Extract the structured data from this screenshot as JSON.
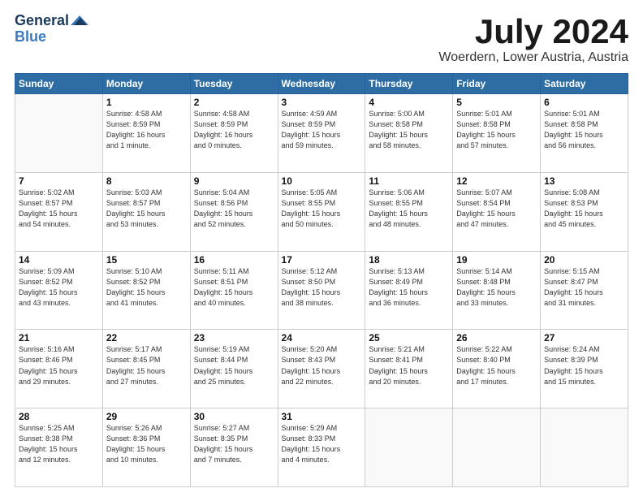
{
  "logo": {
    "line1": "General",
    "line2": "Blue"
  },
  "title": "July 2024",
  "location": "Woerdern, Lower Austria, Austria",
  "weekdays": [
    "Sunday",
    "Monday",
    "Tuesday",
    "Wednesday",
    "Thursday",
    "Friday",
    "Saturday"
  ],
  "weeks": [
    [
      {
        "day": "",
        "info": ""
      },
      {
        "day": "1",
        "info": "Sunrise: 4:58 AM\nSunset: 8:59 PM\nDaylight: 16 hours\nand 1 minute."
      },
      {
        "day": "2",
        "info": "Sunrise: 4:58 AM\nSunset: 8:59 PM\nDaylight: 16 hours\nand 0 minutes."
      },
      {
        "day": "3",
        "info": "Sunrise: 4:59 AM\nSunset: 8:59 PM\nDaylight: 15 hours\nand 59 minutes."
      },
      {
        "day": "4",
        "info": "Sunrise: 5:00 AM\nSunset: 8:58 PM\nDaylight: 15 hours\nand 58 minutes."
      },
      {
        "day": "5",
        "info": "Sunrise: 5:01 AM\nSunset: 8:58 PM\nDaylight: 15 hours\nand 57 minutes."
      },
      {
        "day": "6",
        "info": "Sunrise: 5:01 AM\nSunset: 8:58 PM\nDaylight: 15 hours\nand 56 minutes."
      }
    ],
    [
      {
        "day": "7",
        "info": "Sunrise: 5:02 AM\nSunset: 8:57 PM\nDaylight: 15 hours\nand 54 minutes."
      },
      {
        "day": "8",
        "info": "Sunrise: 5:03 AM\nSunset: 8:57 PM\nDaylight: 15 hours\nand 53 minutes."
      },
      {
        "day": "9",
        "info": "Sunrise: 5:04 AM\nSunset: 8:56 PM\nDaylight: 15 hours\nand 52 minutes."
      },
      {
        "day": "10",
        "info": "Sunrise: 5:05 AM\nSunset: 8:55 PM\nDaylight: 15 hours\nand 50 minutes."
      },
      {
        "day": "11",
        "info": "Sunrise: 5:06 AM\nSunset: 8:55 PM\nDaylight: 15 hours\nand 48 minutes."
      },
      {
        "day": "12",
        "info": "Sunrise: 5:07 AM\nSunset: 8:54 PM\nDaylight: 15 hours\nand 47 minutes."
      },
      {
        "day": "13",
        "info": "Sunrise: 5:08 AM\nSunset: 8:53 PM\nDaylight: 15 hours\nand 45 minutes."
      }
    ],
    [
      {
        "day": "14",
        "info": "Sunrise: 5:09 AM\nSunset: 8:52 PM\nDaylight: 15 hours\nand 43 minutes."
      },
      {
        "day": "15",
        "info": "Sunrise: 5:10 AM\nSunset: 8:52 PM\nDaylight: 15 hours\nand 41 minutes."
      },
      {
        "day": "16",
        "info": "Sunrise: 5:11 AM\nSunset: 8:51 PM\nDaylight: 15 hours\nand 40 minutes."
      },
      {
        "day": "17",
        "info": "Sunrise: 5:12 AM\nSunset: 8:50 PM\nDaylight: 15 hours\nand 38 minutes."
      },
      {
        "day": "18",
        "info": "Sunrise: 5:13 AM\nSunset: 8:49 PM\nDaylight: 15 hours\nand 36 minutes."
      },
      {
        "day": "19",
        "info": "Sunrise: 5:14 AM\nSunset: 8:48 PM\nDaylight: 15 hours\nand 33 minutes."
      },
      {
        "day": "20",
        "info": "Sunrise: 5:15 AM\nSunset: 8:47 PM\nDaylight: 15 hours\nand 31 minutes."
      }
    ],
    [
      {
        "day": "21",
        "info": "Sunrise: 5:16 AM\nSunset: 8:46 PM\nDaylight: 15 hours\nand 29 minutes."
      },
      {
        "day": "22",
        "info": "Sunrise: 5:17 AM\nSunset: 8:45 PM\nDaylight: 15 hours\nand 27 minutes."
      },
      {
        "day": "23",
        "info": "Sunrise: 5:19 AM\nSunset: 8:44 PM\nDaylight: 15 hours\nand 25 minutes."
      },
      {
        "day": "24",
        "info": "Sunrise: 5:20 AM\nSunset: 8:43 PM\nDaylight: 15 hours\nand 22 minutes."
      },
      {
        "day": "25",
        "info": "Sunrise: 5:21 AM\nSunset: 8:41 PM\nDaylight: 15 hours\nand 20 minutes."
      },
      {
        "day": "26",
        "info": "Sunrise: 5:22 AM\nSunset: 8:40 PM\nDaylight: 15 hours\nand 17 minutes."
      },
      {
        "day": "27",
        "info": "Sunrise: 5:24 AM\nSunset: 8:39 PM\nDaylight: 15 hours\nand 15 minutes."
      }
    ],
    [
      {
        "day": "28",
        "info": "Sunrise: 5:25 AM\nSunset: 8:38 PM\nDaylight: 15 hours\nand 12 minutes."
      },
      {
        "day": "29",
        "info": "Sunrise: 5:26 AM\nSunset: 8:36 PM\nDaylight: 15 hours\nand 10 minutes."
      },
      {
        "day": "30",
        "info": "Sunrise: 5:27 AM\nSunset: 8:35 PM\nDaylight: 15 hours\nand 7 minutes."
      },
      {
        "day": "31",
        "info": "Sunrise: 5:29 AM\nSunset: 8:33 PM\nDaylight: 15 hours\nand 4 minutes."
      },
      {
        "day": "",
        "info": ""
      },
      {
        "day": "",
        "info": ""
      },
      {
        "day": "",
        "info": ""
      }
    ]
  ]
}
